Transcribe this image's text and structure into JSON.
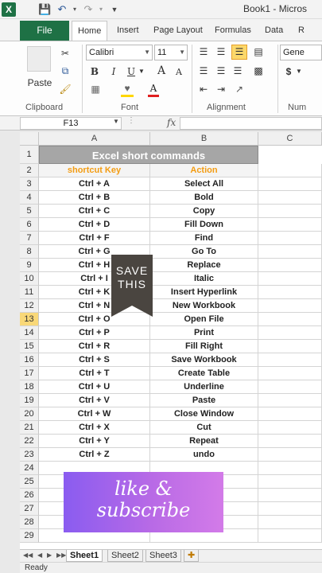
{
  "app": {
    "title": "Book1 - Micros",
    "logo": "X"
  },
  "qat": {
    "save_icon": "save-icon",
    "undo_icon": "undo-icon",
    "redo_icon": "redo-icon"
  },
  "tabs": {
    "file": "File",
    "home": "Home",
    "insert": "Insert",
    "page_layout": "Page Layout",
    "formulas": "Formulas",
    "data": "Data",
    "review": "R"
  },
  "ribbon": {
    "clipboard": {
      "label": "Clipboard",
      "paste": "Paste"
    },
    "font": {
      "label": "Font",
      "font_name": "Calibri",
      "font_size": "11",
      "bold": "B",
      "italic": "I",
      "underline": "U",
      "grow": "A",
      "shrink": "A"
    },
    "alignment": {
      "label": "Alignment"
    },
    "number": {
      "label": "Num",
      "format": "Gene",
      "currency": "$"
    }
  },
  "formula_bar": {
    "name_box": "F13",
    "fx": "fx",
    "value": ""
  },
  "grid": {
    "columns": [
      "A",
      "B",
      "C"
    ],
    "title": "Excel short commands",
    "header": {
      "key": "shortcut Key",
      "action": "Action"
    },
    "rows": [
      {
        "num": "1"
      },
      {
        "num": "2"
      },
      {
        "num": "3",
        "key": "Ctrl + A",
        "action": "Select All"
      },
      {
        "num": "4",
        "key": "Ctrl + B",
        "action": "Bold"
      },
      {
        "num": "5",
        "key": "Ctrl + C",
        "action": "Copy"
      },
      {
        "num": "6",
        "key": "Ctrl + D",
        "action": "Fill Down"
      },
      {
        "num": "7",
        "key": "Ctrl + F",
        "action": "Find"
      },
      {
        "num": "8",
        "key": "Ctrl + G",
        "action": "Go To"
      },
      {
        "num": "9",
        "key": "Ctrl + H",
        "action": "Replace"
      },
      {
        "num": "10",
        "key": "Ctrl + I",
        "action": "Italic"
      },
      {
        "num": "11",
        "key": "Ctrl + K",
        "action": "Insert Hyperlink"
      },
      {
        "num": "12",
        "key": "Ctrl + N",
        "action": "New Workbook"
      },
      {
        "num": "13",
        "key": "Ctrl + O",
        "action": "Open File"
      },
      {
        "num": "14",
        "key": "Ctrl + P",
        "action": "Print"
      },
      {
        "num": "15",
        "key": "Ctrl + R",
        "action": "Fill Right"
      },
      {
        "num": "16",
        "key": "Ctrl + S",
        "action": "Save Workbook"
      },
      {
        "num": "17",
        "key": "Ctrl + T",
        "action": "Create Table"
      },
      {
        "num": "18",
        "key": "Ctrl + U",
        "action": "Underline"
      },
      {
        "num": "19",
        "key": "Ctrl + V",
        "action": "Paste"
      },
      {
        "num": "20",
        "key": "Ctrl + W",
        "action": "Close Window"
      },
      {
        "num": "21",
        "key": "Ctrl + X",
        "action": "Cut"
      },
      {
        "num": "22",
        "key": "Ctrl + Y",
        "action": "Repeat"
      },
      {
        "num": "23",
        "key": "Ctrl + Z",
        "action": "undo"
      },
      {
        "num": "24"
      },
      {
        "num": "25"
      },
      {
        "num": "26"
      },
      {
        "num": "27"
      },
      {
        "num": "28"
      },
      {
        "num": "29"
      }
    ],
    "selected_row": "13"
  },
  "sheets": {
    "tabs": [
      "Sheet1",
      "Sheet2",
      "Sheet3"
    ],
    "active": "Sheet1"
  },
  "status": {
    "text": "Ready"
  },
  "overlays": {
    "save_line1": "SAVE",
    "save_line2": "THIS",
    "like_line1": "like &",
    "like_line2": "subscribe"
  },
  "colors": {
    "excel_green": "#1e7145",
    "header_orange": "#f39c12",
    "title_gray": "#a6a6a6",
    "selected_row": "#f9d878"
  }
}
